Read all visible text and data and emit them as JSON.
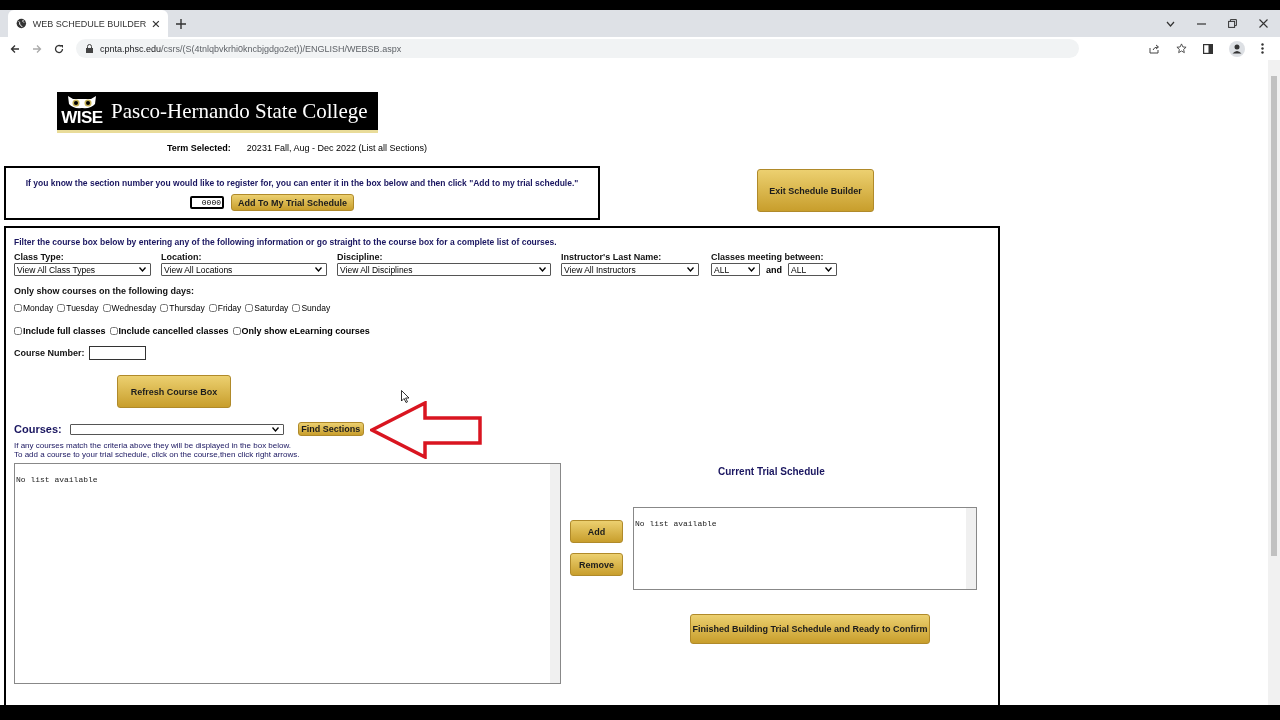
{
  "browser": {
    "tab_title": "WEB SCHEDULE BUILDER",
    "url_host": "cpnta.phsc.edu",
    "url_path": "/csrs/(S(4tnlqbvkrhi0kncbjgdgo2et))/ENGLISH/WEBSB.aspx"
  },
  "header": {
    "logo_badge": "WISE",
    "logo_text": "Pasco-Hernando State College",
    "term_label": "Term Selected:",
    "term_value": "20231 Fall, Aug - Dec 2022 (List all Sections)"
  },
  "quick_add": {
    "instruction": "If you know the section number you would like to register for, you can enter it in the box below and then click \"Add to my trial schedule.\"",
    "section_number": "0000",
    "button": "Add To My Trial Schedule"
  },
  "exit_button": "Exit Schedule Builder",
  "filter": {
    "instruction": "Filter the course box below by entering any of the following information or go straight to the course box for a complete list of courses.",
    "fields": [
      {
        "label": "Class Type:",
        "value": "View All Class Types"
      },
      {
        "label": "Location:",
        "value": "View All Locations"
      },
      {
        "label": "Discipline:",
        "value": "View All Disciplines"
      },
      {
        "label": "Instructor's Last Name:",
        "value": "View All Instructors"
      }
    ],
    "time": {
      "label": "Classes meeting between:",
      "from": "ALL",
      "joiner": "and",
      "to": "ALL"
    },
    "days_label": "Only show courses on the following days:",
    "days": [
      {
        "label": "Monday",
        "checked": false
      },
      {
        "label": "Tuesday",
        "checked": false
      },
      {
        "label": "Wednesday",
        "checked": false
      },
      {
        "label": "Thursday",
        "checked": false
      },
      {
        "label": "Friday",
        "checked": false
      },
      {
        "label": "Saturday",
        "checked": false
      },
      {
        "label": "Sunday",
        "checked": false
      }
    ],
    "options": [
      {
        "label": "Include full classes",
        "checked": false
      },
      {
        "label": "Include cancelled classes",
        "checked": false
      },
      {
        "label": "Only show eLearning courses",
        "checked": false
      }
    ],
    "course_number_label": "Course Number:",
    "refresh_button": "Refresh Course Box"
  },
  "courses": {
    "label": "Courses:",
    "find_button": "Find Sections",
    "hints": [
      "If any courses match the criteria above they will be displayed in the box below.",
      "To add a course to your trial schedule, click on the course,then click right arrows."
    ],
    "list_text": "No list available"
  },
  "trial": {
    "title": "Current Trial Schedule",
    "add_button": "Add",
    "remove_button": "Remove",
    "list_text": "No list available",
    "finish_button": "Finished Building Trial Schedule and Ready to Confirm"
  }
}
